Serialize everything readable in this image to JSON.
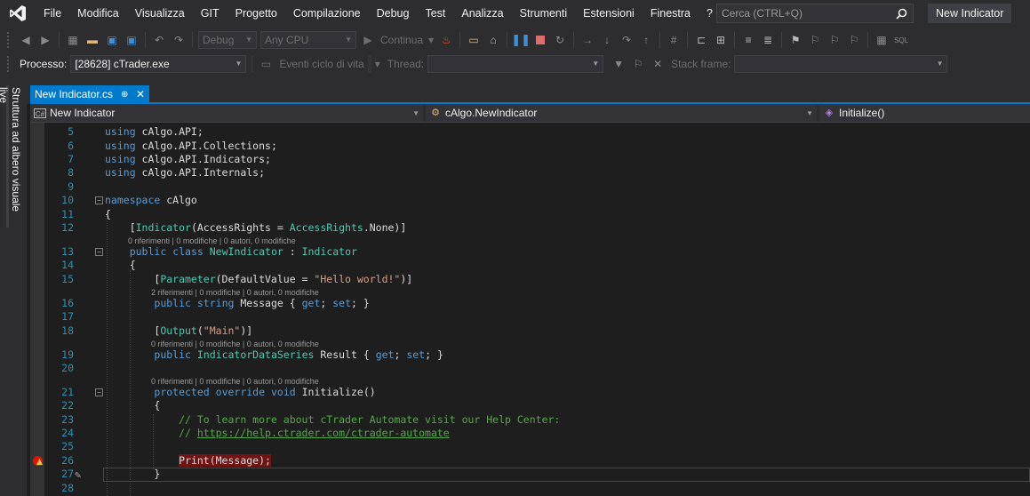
{
  "menubar": {
    "items": [
      "File",
      "Modifica",
      "Visualizza",
      "GIT",
      "Progetto",
      "Compilazione",
      "Debug",
      "Test",
      "Analizza",
      "Strumenti",
      "Estensioni",
      "Finestra",
      "?"
    ],
    "search_placeholder": "Cerca (CTRL+Q)",
    "solution_name": "New Indicator"
  },
  "toolbar": {
    "config": "Debug",
    "platform": "Any CPU",
    "continue_label": "Continua",
    "continue_arrow": "▾"
  },
  "debugbar": {
    "process_label": "Processo:",
    "process_value": "[28628] cTrader.exe",
    "lifecycle_label": "Eventi ciclo di vita",
    "thread_label": "Thread:",
    "stack_label": "Stack frame:"
  },
  "side_panel": {
    "tab_label": "Struttura ad albero visuale live"
  },
  "doc_tab": {
    "title": "New Indicator.cs",
    "pin": "⊕",
    "close": "✕"
  },
  "navbar": {
    "project": "New Indicator",
    "class": "cAlgo.NewIndicator",
    "member": "Initialize()"
  },
  "code": {
    "lines": [
      {
        "n": "5",
        "text": "using cAlgo.API;"
      },
      {
        "n": "6",
        "text": "using cAlgo.API.Collections;"
      },
      {
        "n": "7",
        "text": "using cAlgo.API.Indicators;"
      },
      {
        "n": "8",
        "text": "using cAlgo.API.Internals;"
      },
      {
        "n": "9",
        "text": ""
      },
      {
        "n": "10",
        "text": "namespace cAlgo"
      },
      {
        "n": "11",
        "text": "{"
      },
      {
        "n": "12",
        "text": "[Indicator(AccessRights = AccessRights.None)]"
      },
      {
        "n": "13",
        "text": "public class NewIndicator : Indicator"
      },
      {
        "n": "14",
        "text": "{"
      },
      {
        "n": "15",
        "text": "[Parameter(DefaultValue = \"Hello world!\")]"
      },
      {
        "n": "16",
        "text": "public string Message { get; set; }"
      },
      {
        "n": "17",
        "text": ""
      },
      {
        "n": "18",
        "text": "[Output(\"Main\")]"
      },
      {
        "n": "19",
        "text": "public IndicatorDataSeries Result { get; set; }"
      },
      {
        "n": "20",
        "text": ""
      },
      {
        "n": "21",
        "text": "protected override void Initialize()"
      },
      {
        "n": "22",
        "text": "{"
      },
      {
        "n": "23",
        "text": "// To learn more about cTrader Automate visit our Help Center:"
      },
      {
        "n": "24",
        "text": "// https://help.ctrader.com/ctrader-automate"
      },
      {
        "n": "25",
        "text": ""
      },
      {
        "n": "26",
        "text": "Print(Message);"
      },
      {
        "n": "27",
        "text": "}"
      },
      {
        "n": "28",
        "text": ""
      }
    ],
    "lens": [
      "0 riferimenti | 0 modifiche | 0 autori, 0 modifiche",
      "2 riferimenti | 0 modifiche | 0 autori, 0 modifiche",
      "0 riferimenti | 0 modifiche | 0 autori, 0 modifiche",
      "0 riferimenti | 0 modifiche | 0 autori, 0 modifiche"
    ]
  },
  "colors": {
    "accent": "#007acc",
    "keyword": "#569cd6",
    "type": "#4ec9b0",
    "string": "#d69d85",
    "comment": "#57a64a",
    "line_number": "#2b91af",
    "breakpoint_highlight": "#6f1313"
  }
}
